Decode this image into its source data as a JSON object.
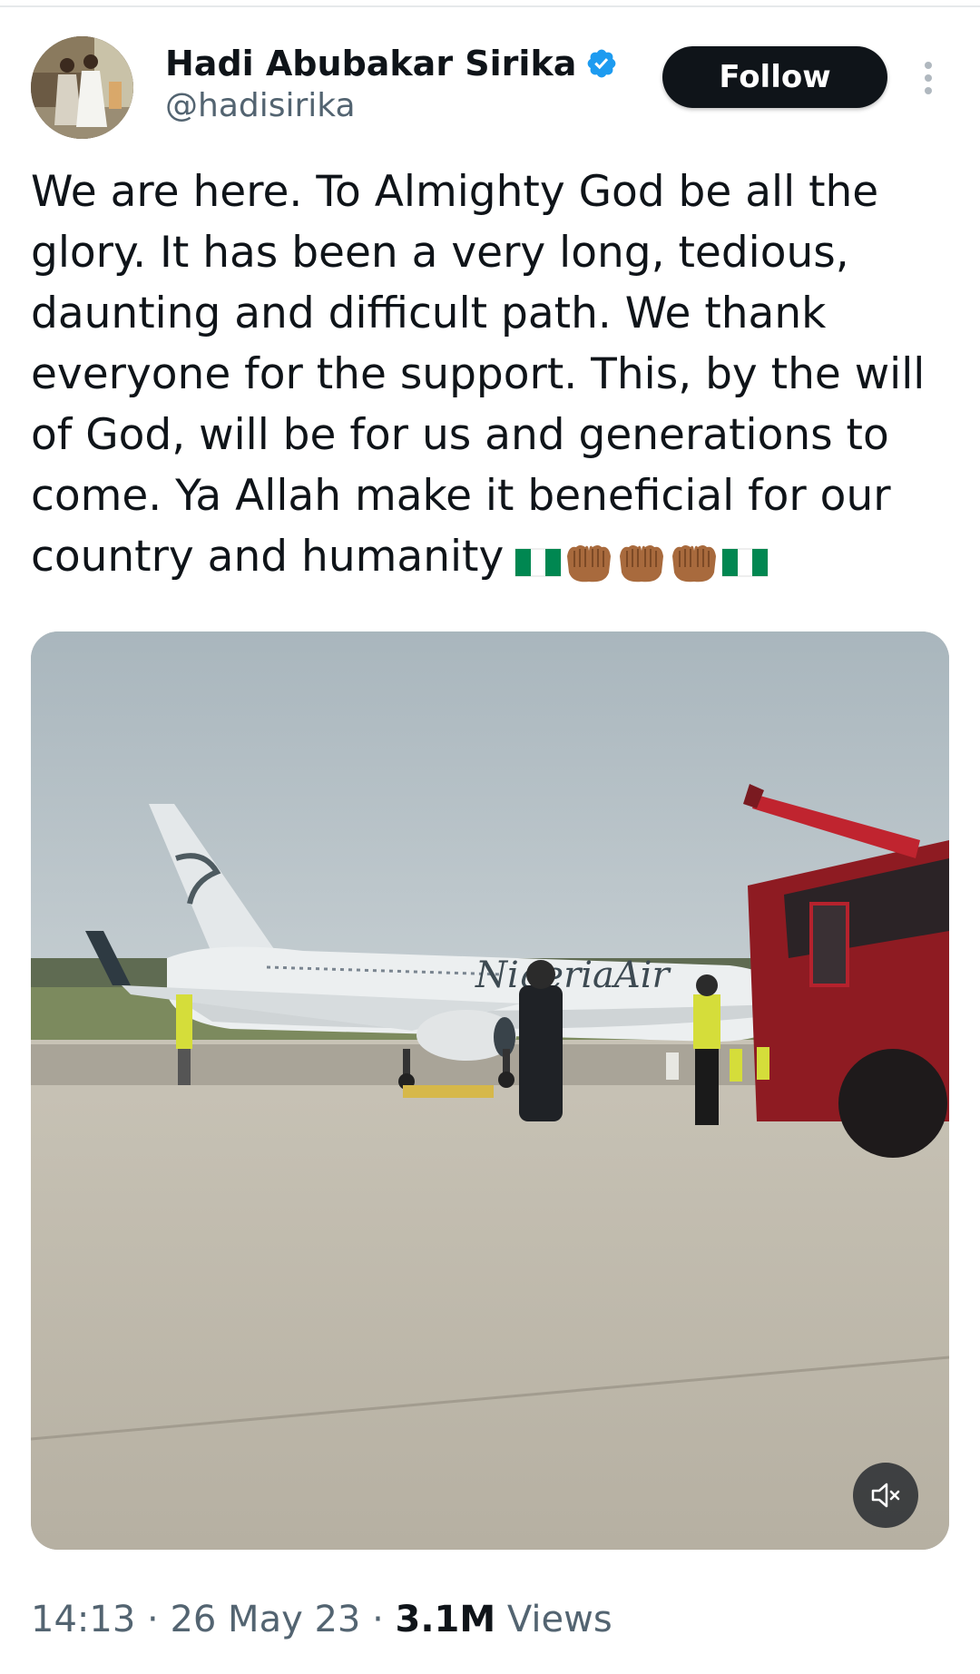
{
  "author": {
    "name": "Hadi Abubakar Sirika",
    "handle": "@hadisirika"
  },
  "actions": {
    "follow_label": "Follow"
  },
  "tweet": {
    "text": "We are here. To Almighty God be all the glory. It has been a very long, tedious, daunting and difficult path. We thank everyone for the support. This, by the will of God, will be for us and generations to come. Ya Allah make it beneficial for our country and humanity"
  },
  "media": {
    "aircraft_livery": "NigeriaAir"
  },
  "meta": {
    "time": "14:13",
    "separator": " · ",
    "date": "26 May 23",
    "views_count": "3.1M",
    "views_label": " Views"
  },
  "icons": {
    "verified": "verified-badge-icon",
    "more": "more-options-icon",
    "mute": "volume-muted-icon",
    "flag": "nigeria-flag-emoji",
    "hands": "palms-up-together-emoji"
  },
  "colors": {
    "verified_blue": "#1d9bf0",
    "follow_bg": "#0f1419",
    "secondary_text": "#536471",
    "flag_green": "#008751"
  }
}
